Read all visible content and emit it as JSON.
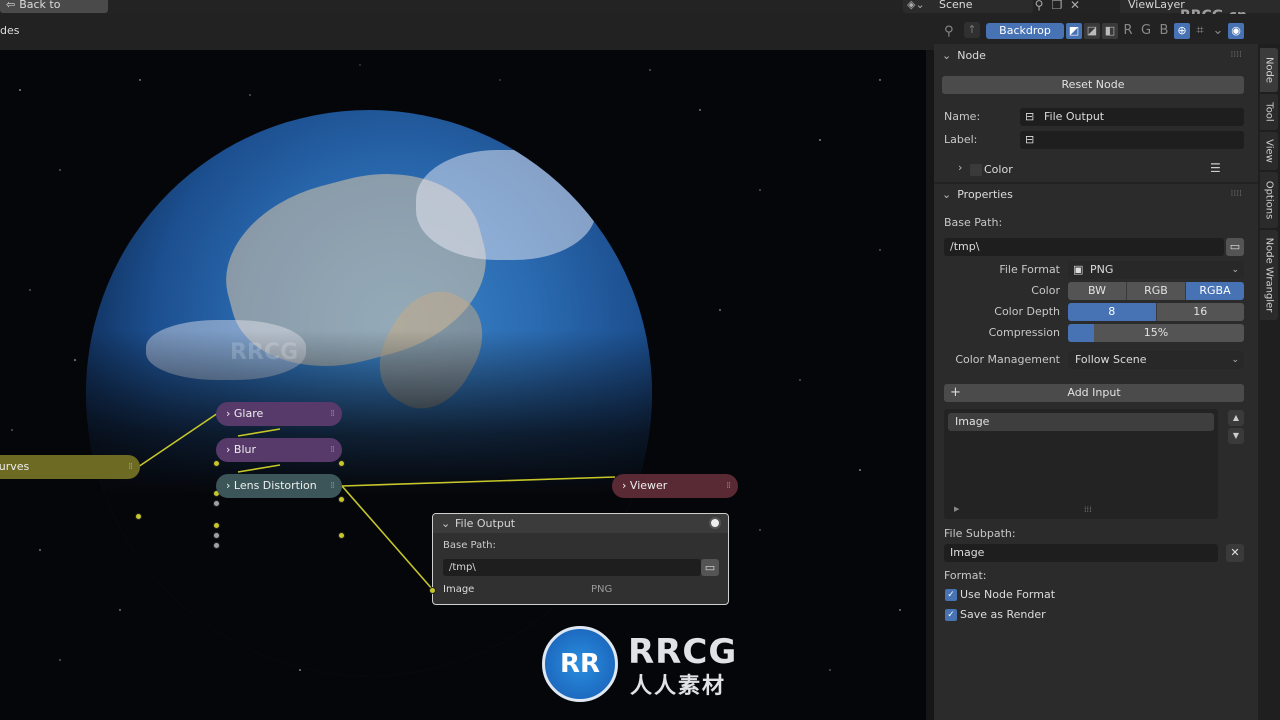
{
  "topbar": {
    "back_label": "Back to Previous",
    "scene_label": "Scene",
    "viewlayer_label": "ViewLayer",
    "watermark_top": "RRCG.cn"
  },
  "header": {
    "editor_title": "des",
    "backdrop_label": "Backdrop",
    "channel_r": "R",
    "channel_g": "G",
    "channel_b": "B"
  },
  "nodes": {
    "curves_label": "B Curves",
    "glare_label": "Glare",
    "blur_label": "Blur",
    "lens_label": "Lens Distortion",
    "viewer_label": "Viewer",
    "file_output": {
      "title": "File Output",
      "base_path_label": "Base Path:",
      "path_value": "/tmp\\",
      "input_label": "Image",
      "format_value": "PNG"
    },
    "colors": {
      "curves": "#6d6a24",
      "glare": "#573a6a",
      "blur": "#573a6a",
      "lens": "#3b5558",
      "viewer": "#5a2a34",
      "socket": "#c7c729"
    }
  },
  "watermark": {
    "logo": "RR",
    "brand": "RRCG",
    "brand_cn": "人人素材"
  },
  "sidebar": {
    "node_panel": {
      "title": "Node",
      "reset_label": "Reset Node",
      "name_label": "Name:",
      "name_value": "File Output",
      "label_label": "Label:",
      "label_value": "",
      "color_label": "Color"
    },
    "properties_panel": {
      "title": "Properties",
      "base_path_label": "Base Path:",
      "base_path_value": "/tmp\\",
      "file_format_label": "File Format",
      "file_format_value": "PNG",
      "color_label": "Color",
      "color_options": [
        "BW",
        "RGB",
        "RGBA"
      ],
      "color_selected": "RGBA",
      "color_depth_label": "Color Depth",
      "color_depth_options": [
        "8",
        "16"
      ],
      "color_depth_selected": "8",
      "compression_label": "Compression",
      "compression_value": "15%",
      "compression_fraction": 0.15,
      "color_management_label": "Color Management",
      "color_management_value": "Follow Scene",
      "add_input_label": "Add Input",
      "inputs": [
        "Image"
      ],
      "file_subpath_label": "File Subpath:",
      "file_subpath_value": "Image",
      "format_label": "Format:",
      "use_node_format_label": "Use Node Format",
      "save_as_render_label": "Save as Render"
    },
    "tabs": [
      "Node",
      "Tool",
      "View",
      "Options",
      "Node Wrangler"
    ],
    "accent_color": "#4772b3"
  }
}
